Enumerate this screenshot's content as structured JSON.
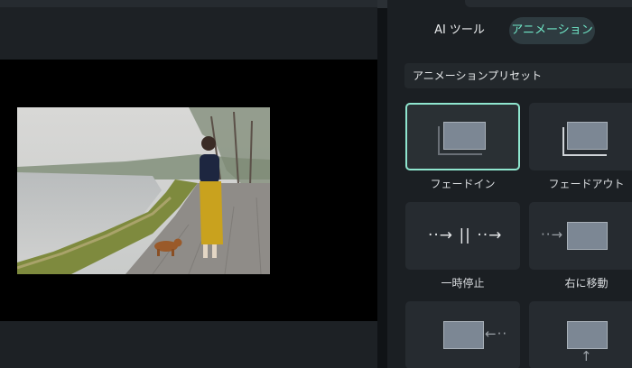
{
  "panel": {
    "tabs": [
      {
        "label": "AI ツール",
        "active": false
      },
      {
        "label": "アニメーション",
        "active": true
      }
    ],
    "preset_header": "アニメーションプリセット",
    "presets": [
      {
        "label": "フェードイン",
        "icon": "fade-in-icon",
        "selected": true
      },
      {
        "label": "フェードアウト",
        "icon": "fade-out-icon",
        "selected": false
      },
      {
        "label": "一時停止",
        "icon": "pause-icon",
        "selected": false
      },
      {
        "label": "右に移動",
        "icon": "move-right-icon",
        "selected": false
      },
      {
        "label": "",
        "icon": "move-left-icon",
        "selected": false
      },
      {
        "label": "",
        "icon": "move-up-icon",
        "selected": false
      }
    ],
    "glyphs": {
      "pause": "··→ || ··→",
      "move_right": "··→",
      "move_left": "←··",
      "move_up": "↑"
    }
  },
  "colors": {
    "accent": "#6fe6c6",
    "selected_border": "#8fe6cf",
    "panel_bg": "#1b1f23",
    "card_bg": "#262b30"
  }
}
